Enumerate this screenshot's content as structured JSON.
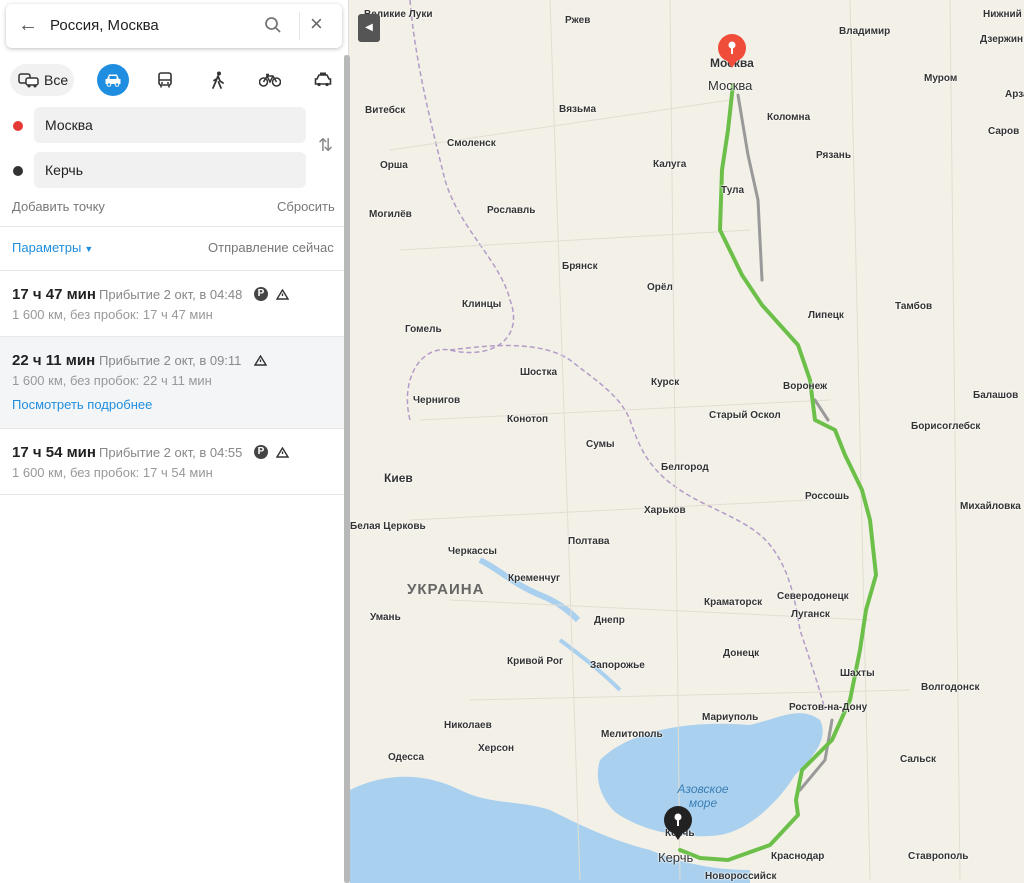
{
  "search": {
    "value": "Россия, Москва"
  },
  "modes": {
    "all_label": "Все"
  },
  "route_points": {
    "from": "Москва",
    "to": "Керчь",
    "add_point": "Добавить точку",
    "reset": "Сбросить"
  },
  "options": {
    "params_label": "Параметры",
    "departure": "Отправление сейчас"
  },
  "routes": [
    {
      "duration": "17 ч 47 мин",
      "arrival": "Прибытие 2 окт, в 04:48",
      "details": "1 600 км, без пробок: 17 ч 47 мин",
      "paid_badge": "P"
    },
    {
      "duration": "22 ч 11 мин",
      "arrival": "Прибытие 2 окт, в 09:11",
      "details": "1 600 км, без пробок: 22 ч 11 мин",
      "more": "Посмотреть подробнее"
    },
    {
      "duration": "17 ч 54 мин",
      "arrival": "Прибытие 2 окт, в 04:55",
      "details": "1 600 км, без пробок: 17 ч 54 мин",
      "paid_badge": "P"
    }
  ],
  "map": {
    "country": "УКРАИНА",
    "sea": "Азовское море",
    "start_label": "Москва",
    "end_label": "Керчь",
    "route_color": "#6cc04a",
    "alt_route_color": "#999999",
    "start_pin_color": "#f04d3b",
    "end_pin_color": "#222222",
    "cities": [
      {
        "name": "Великие Луки",
        "cls": ""
      },
      {
        "name": "Ржев",
        "cls": ""
      },
      {
        "name": "Москва",
        "cls": "big"
      },
      {
        "name": "Владимир",
        "cls": ""
      },
      {
        "name": "Нижний",
        "cls": ""
      },
      {
        "name": "Дзержин",
        "cls": ""
      },
      {
        "name": "Муром",
        "cls": ""
      },
      {
        "name": "Арза",
        "cls": ""
      },
      {
        "name": "Витебск",
        "cls": ""
      },
      {
        "name": "Вязьма",
        "cls": ""
      },
      {
        "name": "Коломна",
        "cls": ""
      },
      {
        "name": "Саров",
        "cls": ""
      },
      {
        "name": "Орша",
        "cls": ""
      },
      {
        "name": "Смоленск",
        "cls": ""
      },
      {
        "name": "Калуга",
        "cls": ""
      },
      {
        "name": "Рязань",
        "cls": ""
      },
      {
        "name": "Тула",
        "cls": ""
      },
      {
        "name": "Могилёв",
        "cls": ""
      },
      {
        "name": "Рославль",
        "cls": ""
      },
      {
        "name": "Брянск",
        "cls": ""
      },
      {
        "name": "Орёл",
        "cls": ""
      },
      {
        "name": "Липецк",
        "cls": ""
      },
      {
        "name": "Тамбов",
        "cls": ""
      },
      {
        "name": "Клинцы",
        "cls": ""
      },
      {
        "name": "Гомель",
        "cls": ""
      },
      {
        "name": "Шостка",
        "cls": ""
      },
      {
        "name": "Курск",
        "cls": ""
      },
      {
        "name": "Воронеж",
        "cls": ""
      },
      {
        "name": "Балашов",
        "cls": ""
      },
      {
        "name": "Чернигов",
        "cls": ""
      },
      {
        "name": "Конотоп",
        "cls": ""
      },
      {
        "name": "Старый Оскол",
        "cls": ""
      },
      {
        "name": "Борисоглебск",
        "cls": ""
      },
      {
        "name": "Сумы",
        "cls": ""
      },
      {
        "name": "Белгород",
        "cls": ""
      },
      {
        "name": "Киев",
        "cls": "big"
      },
      {
        "name": "Россошь",
        "cls": ""
      },
      {
        "name": "Харьков",
        "cls": ""
      },
      {
        "name": "Михайловка",
        "cls": ""
      },
      {
        "name": "Белая Церковь",
        "cls": ""
      },
      {
        "name": "Полтава",
        "cls": ""
      },
      {
        "name": "Черкассы",
        "cls": ""
      },
      {
        "name": "Кременчуг",
        "cls": ""
      },
      {
        "name": "Северодонецк",
        "cls": ""
      },
      {
        "name": "Краматорск",
        "cls": ""
      },
      {
        "name": "Луганск",
        "cls": ""
      },
      {
        "name": "Днепр",
        "cls": ""
      },
      {
        "name": "Умань",
        "cls": ""
      },
      {
        "name": "Донецк",
        "cls": ""
      },
      {
        "name": "Кривой Рог",
        "cls": ""
      },
      {
        "name": "Запорожье",
        "cls": ""
      },
      {
        "name": "Шахты",
        "cls": ""
      },
      {
        "name": "Волгодонск",
        "cls": ""
      },
      {
        "name": "Ростов-на-Дону",
        "cls": ""
      },
      {
        "name": "Мариуполь",
        "cls": ""
      },
      {
        "name": "Николаев",
        "cls": ""
      },
      {
        "name": "Мелитополь",
        "cls": ""
      },
      {
        "name": "Херсон",
        "cls": ""
      },
      {
        "name": "Одесса",
        "cls": ""
      },
      {
        "name": "Сальск",
        "cls": ""
      },
      {
        "name": "Краснодар",
        "cls": ""
      },
      {
        "name": "Ставрополь",
        "cls": ""
      },
      {
        "name": "Керчь",
        "cls": ""
      },
      {
        "name": "Новороссийск",
        "cls": ""
      }
    ]
  }
}
